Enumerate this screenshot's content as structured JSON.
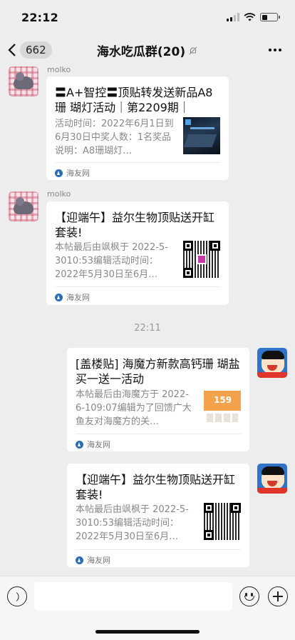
{
  "status": {
    "time": "22:12"
  },
  "nav": {
    "back_count": "662",
    "title": "海水吃瓜群(20)"
  },
  "timestamp": "22:11",
  "messages": [
    {
      "sender": "molko",
      "title": "〓A+智控〓顶贴转发送新品A8珊 瑚灯活动｜第2209期｜",
      "desc": "活动时间：2022年6月1日到6月30日中奖人数：1名奖品说明：A8珊瑚灯…",
      "source": "海友网",
      "thumb": "coral-light-image"
    },
    {
      "sender": "molko",
      "title": "【迎端午】益尔生物顶贴送开缸套装!",
      "desc": "本帖最后由飒枫于 2022-5-3010:53编辑活动时间：2022年5月30日至6月…",
      "source": "海友网",
      "thumb": "qr-code-image"
    },
    {
      "title": "[盖楼贴] 海魔方新款高钙珊 瑚盐买一送一活动",
      "desc": "本帖最后由海魔方于 2022-6-109:07编辑为了回馈广大鱼友对海魔方的关…",
      "source": "海友网",
      "thumb": "salt-promo-image",
      "thumb_text": "159"
    },
    {
      "title": "【迎端午】益尔生物顶贴送开缸套装!",
      "desc": "本帖最后由飒枫于 2022-5-3010:53编辑活动时间：2022年5月30日至6月…",
      "source": "海友网",
      "thumb": "qr-code-image"
    }
  ],
  "input": {
    "value": ""
  }
}
